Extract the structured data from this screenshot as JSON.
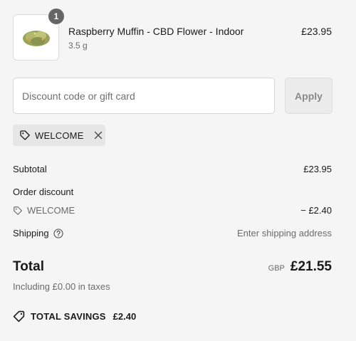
{
  "product": {
    "quantity": "1",
    "name": "Raspberry Muffin - CBD Flower - Indoor",
    "variant": "3.5 g",
    "price": "£23.95",
    "thumbnail_icon": "cannabis-flower-image"
  },
  "discount": {
    "placeholder": "Discount code or gift card",
    "value": "",
    "apply_label": "Apply"
  },
  "applied_code": {
    "code": "WELCOME",
    "icon": "tag-icon",
    "remove_icon": "close-icon"
  },
  "summary": {
    "subtotal_label": "Subtotal",
    "subtotal_value": "£23.95",
    "order_discount_label": "Order discount",
    "discount_code": "WELCOME",
    "discount_value": "− £2.40",
    "shipping_label": "Shipping",
    "shipping_value": "Enter shipping address",
    "shipping_help_icon": "help-circle-icon"
  },
  "total": {
    "label": "Total",
    "currency": "GBP",
    "amount": "£21.55",
    "taxes_note": "Including £0.00 in taxes"
  },
  "savings": {
    "icon": "discount-tag-icon",
    "label": "TOTAL SAVINGS",
    "amount": "£2.40"
  },
  "colors": {
    "background": "#f5f5f5",
    "badge": "#666666",
    "muted_text": "#6b6b6b"
  }
}
